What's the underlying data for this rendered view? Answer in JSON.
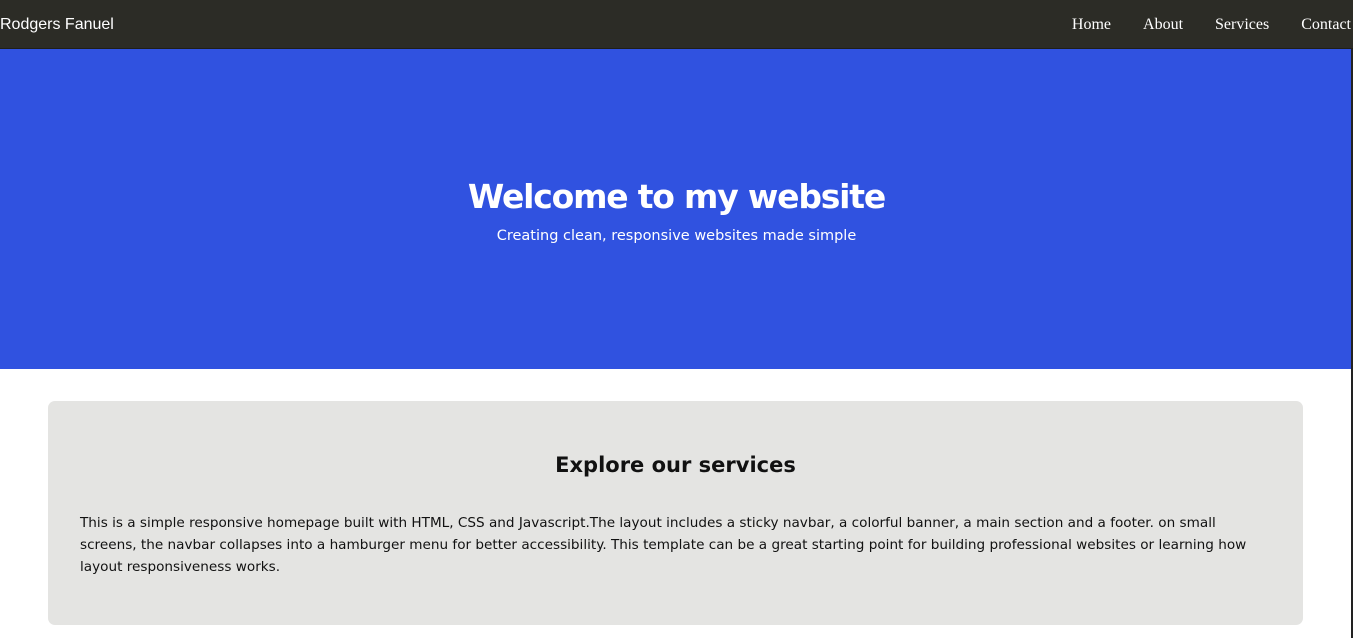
{
  "navbar": {
    "brand": "Rodgers Fanuel",
    "links": [
      "Home",
      "About",
      "Services",
      "Contact"
    ]
  },
  "hero": {
    "title": "Welcome to my website",
    "subtitle": "Creating clean, responsive websites made simple"
  },
  "services": {
    "title": "Explore our services",
    "description": "This is a simple responsive homepage built with HTML, CSS and Javascript.The layout includes a sticky navbar, a colorful banner, a main section and a footer. on small screens, the navbar collapses into a hamburger menu for better accessibility. This template can be a great starting point for building professional websites or learning how layout responsiveness works."
  },
  "colors": {
    "navbar_bg": "#2c2c26",
    "hero_bg": "#3052e0",
    "card_bg": "#e4e4e2",
    "text_light": "#ffffff",
    "text_dark": "#111111"
  }
}
